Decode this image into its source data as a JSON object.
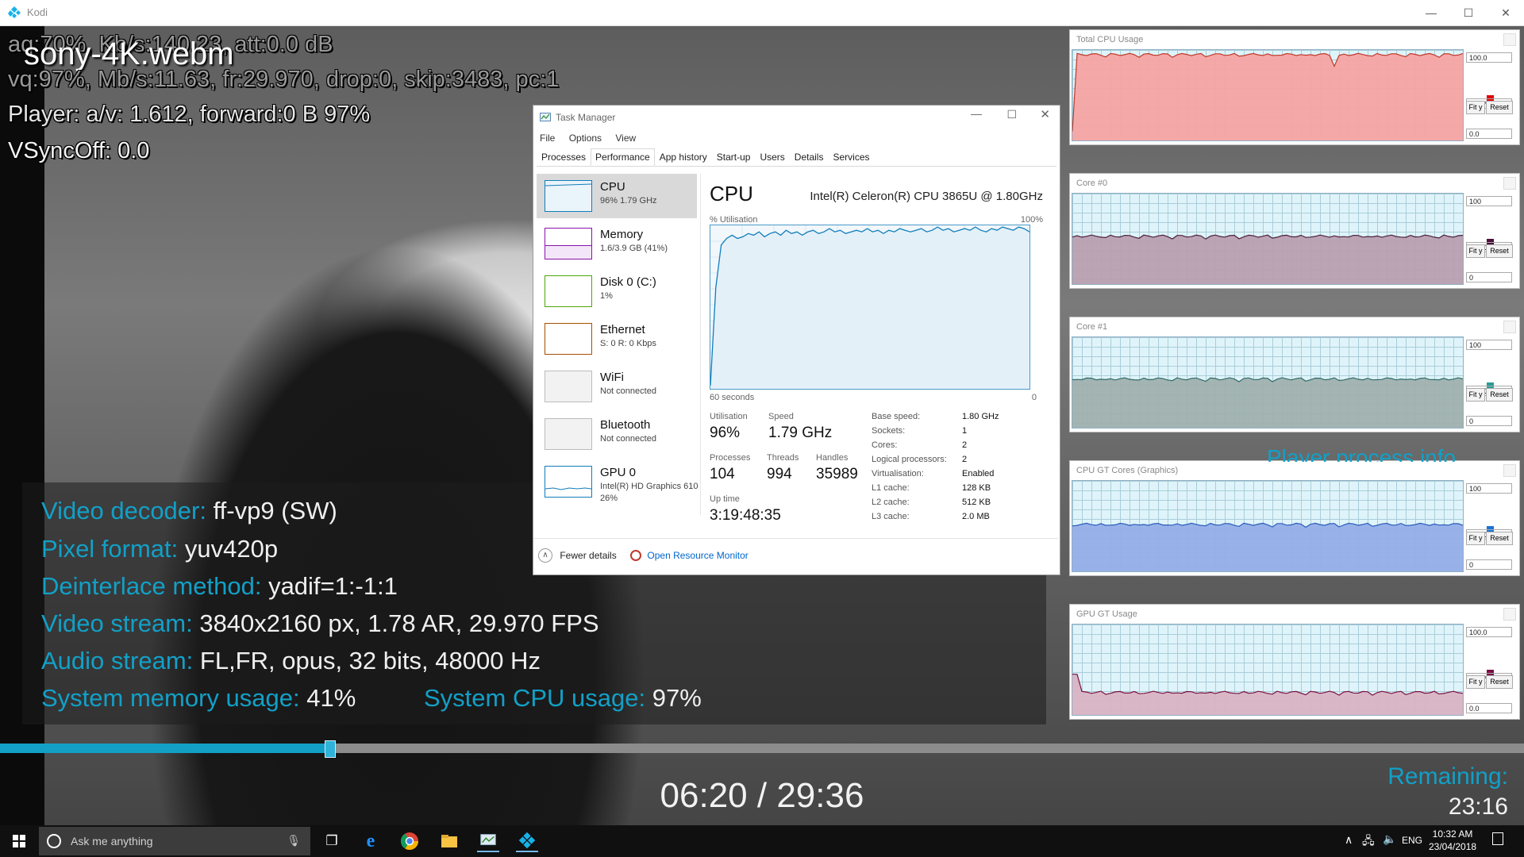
{
  "window": {
    "title": "Kodi",
    "min": "—",
    "max": "☐",
    "close": "✕"
  },
  "osd": {
    "file_title": "sony-4K.webm",
    "line_audio": "aq:70%, Kb/s:140.23, att:0.0 dB",
    "line_video": "vq:97%, Mb/s:11.63, fr:29.970, drop:0, skip:3483, pc:1",
    "line_player": "Player: a/v: 1.612,  forward:0 B 97%",
    "line_vsync": "VSyncOff: 0.0"
  },
  "codec_info": [
    {
      "key": "Video decoder:",
      "value": "ff-vp9 (SW)"
    },
    {
      "key": "Pixel format:",
      "value": "yuv420p"
    },
    {
      "key": "Deinterlace method:",
      "value": "yadif=1:-1:1"
    },
    {
      "key": "Video stream:",
      "value": "3840x2160 px, 1.78 AR, 29.970 FPS"
    },
    {
      "key": "Audio stream:",
      "value": "FL,FR, opus, 32 bits, 48000 Hz"
    }
  ],
  "system_usage": {
    "mem_key": "System memory usage:",
    "mem_value": "41%",
    "cpu_key": "System CPU usage:",
    "cpu_value": "97%"
  },
  "playback": {
    "progress": 0.216,
    "timecode": "06:20 / 29:36",
    "remaining_label": "Remaining:",
    "remaining_value": "23:16",
    "player_process_info_label": "Player process info"
  },
  "task_manager": {
    "title": "Task Manager",
    "menu": [
      "File",
      "Options",
      "View"
    ],
    "tabs": [
      "Processes",
      "Performance",
      "App history",
      "Start-up",
      "Users",
      "Details",
      "Services"
    ],
    "active_tab": "Performance",
    "devices": [
      {
        "name": "CPU",
        "sub": "96% 1.79 GHz",
        "color": "#117dbb"
      },
      {
        "name": "Memory",
        "sub": "1.6/3.9 GB (41%)",
        "color": "#8b12ae"
      },
      {
        "name": "Disk 0 (C:)",
        "sub": "1%",
        "color": "#4da60c"
      },
      {
        "name": "Ethernet",
        "sub": "S: 0 R: 0 Kbps",
        "color": "#a74f01"
      },
      {
        "name": "WiFi",
        "sub": "Not connected",
        "color": "#bbbbbb"
      },
      {
        "name": "Bluetooth",
        "sub": "Not connected",
        "color": "#bbbbbb"
      },
      {
        "name": "GPU 0",
        "sub": "Intel(R) HD Graphics 610",
        "sub2": "26%",
        "color": "#117dbb"
      }
    ],
    "cpu_heading": "CPU",
    "cpu_model": "Intel(R) Celeron(R) CPU 3865U @ 1.80GHz",
    "util_label": "% Utilisation",
    "util_max": "100%",
    "graph_span": "60 seconds",
    "graph_zero": "0",
    "cpu_history": [
      2,
      62,
      88,
      92,
      94,
      92,
      93,
      95,
      94,
      96,
      93,
      95,
      96,
      94,
      97,
      95,
      96,
      94,
      96,
      97,
      95,
      96,
      98,
      96,
      97,
      95,
      96,
      97,
      96,
      98,
      96,
      97,
      95,
      97,
      96,
      98,
      97,
      96,
      97,
      98,
      96,
      97,
      99,
      97,
      98,
      96,
      97,
      98,
      97,
      99,
      97,
      96,
      98,
      97,
      99,
      98,
      97,
      99,
      98,
      96
    ],
    "stats": {
      "util_k": "Utilisation",
      "util_v": "96%",
      "speed_k": "Speed",
      "speed_v": "1.79 GHz",
      "proc_k": "Processes",
      "proc_v": "104",
      "thr_k": "Threads",
      "thr_v": "994",
      "hnd_k": "Handles",
      "hnd_v": "35989",
      "up_k": "Up time",
      "up_v": "3:19:48:35"
    },
    "specs": [
      {
        "k": "Base speed:",
        "v": "1.80 GHz"
      },
      {
        "k": "Sockets:",
        "v": "1"
      },
      {
        "k": "Cores:",
        "v": "2"
      },
      {
        "k": "Logical processors:",
        "v": "2"
      },
      {
        "k": "Virtualisation:",
        "v": "Enabled"
      },
      {
        "k": "L1 cache:",
        "v": "128 KB"
      },
      {
        "k": "L2 cache:",
        "v": "512 KB"
      },
      {
        "k": "L3 cache:",
        "v": "2.0 MB"
      }
    ],
    "fewer_details": "Fewer details",
    "resource_monitor": "Open Resource Monitor"
  },
  "perf_graphs": [
    {
      "title": "Total CPU Usage",
      "max": "100.0",
      "value": "98.9 %",
      "min": "0.0",
      "fill": "#f5a3a3",
      "line": "#c0392b",
      "swatch": "#e00000",
      "level": 0.95
    },
    {
      "title": "Core #0",
      "max": "100",
      "value": "53 °C",
      "min": "0",
      "fill": "#b89fb0",
      "line": "#4b1f3c",
      "swatch": "#4b0f3a",
      "level": 0.53
    },
    {
      "title": "Core #1",
      "max": "100",
      "value": "54 °C",
      "min": "0",
      "fill": "#9fb0ae",
      "line": "#2f6b66",
      "swatch": "#2a9a96",
      "level": 0.54
    },
    {
      "title": "CPU GT Cores (Graphics)",
      "max": "100",
      "value": "52 °C",
      "min": "0",
      "fill": "#94aee8",
      "line": "#2a5bb8",
      "swatch": "#1a73d6",
      "level": 0.52
    },
    {
      "title": "GPU GT Usage",
      "max": "100.0",
      "value": "25.0 %",
      "min": "0.0",
      "fill": "#d8b3c4",
      "line": "#7a1040",
      "swatch": "#7a0f45",
      "level": 0.25
    }
  ],
  "perf_buttons": {
    "fit": "Fit y",
    "reset": "Reset"
  },
  "taskbar": {
    "search_placeholder": "Ask me anything",
    "language": "ENG",
    "time": "10:32 AM",
    "date": "23/04/2018"
  }
}
